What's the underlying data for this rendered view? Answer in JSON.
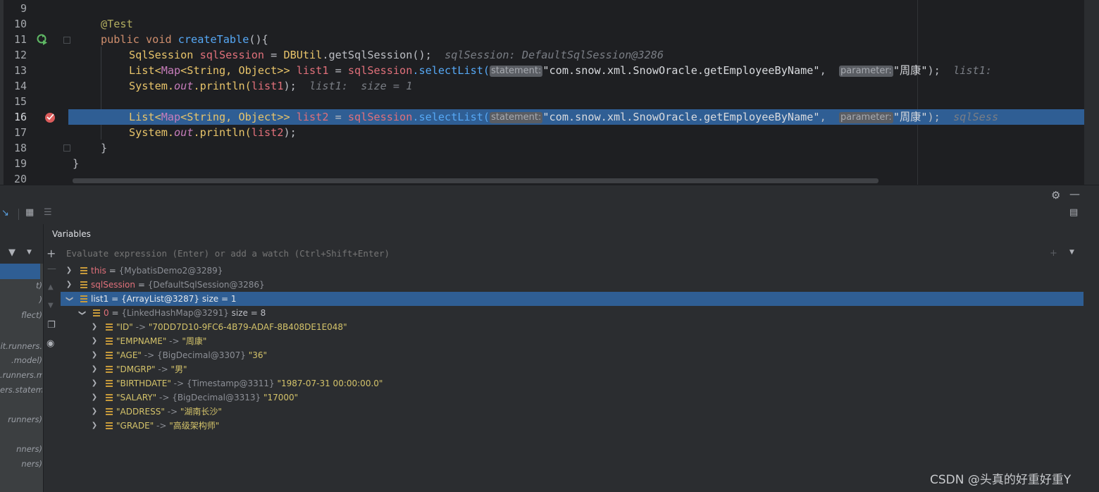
{
  "editor": {
    "lines": [
      {
        "n": "9"
      },
      {
        "n": "10"
      },
      {
        "n": "11"
      },
      {
        "n": "12"
      },
      {
        "n": "13"
      },
      {
        "n": "14"
      },
      {
        "n": "15"
      },
      {
        "n": "16"
      },
      {
        "n": "17"
      },
      {
        "n": "18"
      },
      {
        "n": "19"
      },
      {
        "n": "20"
      }
    ],
    "code": {
      "l10_ann": "@Test",
      "l11_public": "public",
      "l11_void": "void",
      "l11_name": "createTable",
      "l11_rest": "(){",
      "l12_type": "SqlSession",
      "l12_var": "sqlSession",
      "l12_eq": " = ",
      "l12_cls": "DBUtil",
      "l12_call": ".getSqlSession();",
      "l12_hint": "sqlSession: DefaultSqlSession@3286",
      "list_type_a": "List<",
      "list_type_b": "Map",
      "list_type_c": "<String, Object>> ",
      "l13_var": "list1",
      "eq": " = ",
      "session_ref": "sqlSession",
      "select_call": ".selectList(",
      "inlay_statement": "statement:",
      "statement_str": "\"com.snow.xml.SnowOracle.getEmployeeByName\"",
      "comma": ", ",
      "inlay_parameter": "parameter:",
      "param_str": "\"周康\"",
      "close": ");",
      "l13_hint": "list1:",
      "system": "System.",
      "out": "out",
      "println": ".println(",
      "l14_arg": "list1",
      "l14_close": ");",
      "l14_hint": "list1:  size = 1",
      "l16_var": "list2",
      "l16_hint": "sqlSess",
      "l17_arg": "list2",
      "l18": "}",
      "l19": "}"
    }
  },
  "debug": {
    "variables_title": "Variables",
    "eval_placeholder": "Evaluate expression (Enter) or add a watch (Ctrl+Shift+Enter)",
    "frames": [
      "t)",
      ")",
      "flect)",
      "it.runners.",
      ".model)",
      ".runners.m",
      "ers.stateme",
      "runners)",
      "nners)",
      "ners)"
    ],
    "tree": [
      {
        "name": "this",
        "eq": " = ",
        "val": "{MybatisDemo2@3289}"
      },
      {
        "name": "sqlSession",
        "eq": " = ",
        "val": "{DefaultSqlSession@3286}"
      },
      {
        "name": "list1",
        "eq": " = ",
        "val": "{ArrayList@3287}",
        "extra": "  size = 1"
      },
      {
        "name": "0",
        "eq": " = ",
        "val": "{LinkedHashMap@3291}",
        "extra": "  size = 8"
      },
      {
        "key": "\"ID\"",
        "arrow": " -> ",
        "ref": "",
        "value": "\"70DD7D10-9FC6-4B79-ADAF-8B408DE1E048\""
      },
      {
        "key": "\"EMPNAME\"",
        "arrow": " -> ",
        "ref": "",
        "value": "\"周康\""
      },
      {
        "key": "\"AGE\"",
        "arrow": " -> ",
        "ref": "{BigDecimal@3307} ",
        "value": "\"36\""
      },
      {
        "key": "\"DMGRP\"",
        "arrow": " -> ",
        "ref": "",
        "value": "\"男\""
      },
      {
        "key": "\"BIRTHDATE\"",
        "arrow": " -> ",
        "ref": "{Timestamp@3311} ",
        "value": "\"1987-07-31 00:00:00.0\""
      },
      {
        "key": "\"SALARY\"",
        "arrow": " -> ",
        "ref": "{BigDecimal@3313} ",
        "value": "\"17000\""
      },
      {
        "key": "\"ADDRESS\"",
        "arrow": " -> ",
        "ref": "",
        "value": "\"湖南长沙\""
      },
      {
        "key": "\"GRADE\"",
        "arrow": " -> ",
        "ref": "",
        "value": "\"高级架构师\""
      }
    ]
  },
  "watermark": "CSDN @头真的好重好重Y",
  "colors": {
    "selection": "#2f5e94",
    "editor_bg": "#1e1f22",
    "panel_bg": "#2b2d30"
  }
}
